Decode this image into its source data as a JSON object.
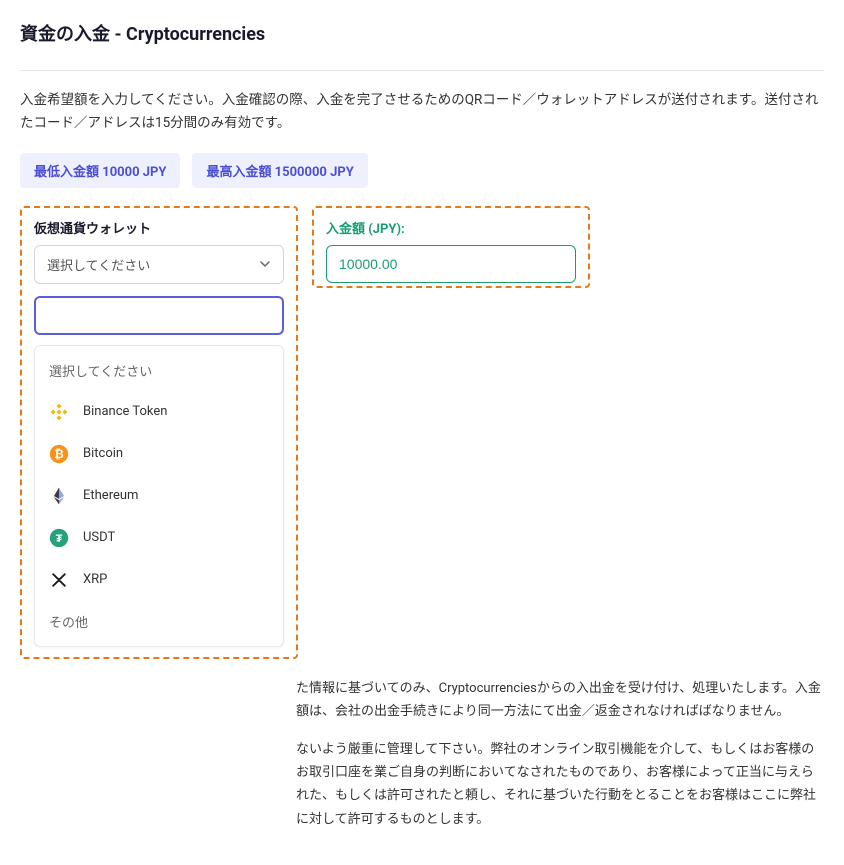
{
  "page": {
    "title": "資金の入金 - Cryptocurrencies",
    "instructions": "入金希望額を入力してください。入金確認の際、入金を完了させるためのQRコード／ウォレットアドレスが送付されます。送付されたコード／アドレスは15分間のみ有効です。"
  },
  "badges": {
    "min": "最低入金額 10000 JPY",
    "max": "最高入金額 1500000 JPY"
  },
  "wallet": {
    "label": "仮想通貨ウォレット",
    "placeholder": "選択してください",
    "options": {
      "placeholder": "選択してください",
      "binance": "Binance Token",
      "bitcoin": "Bitcoin",
      "ethereum": "Ethereum",
      "usdt": "USDT",
      "xrp": "XRP",
      "other": "その他"
    }
  },
  "amount": {
    "label": "入金額 (JPY):",
    "value": "10000.00"
  },
  "body": {
    "p1": "た情報に基づいてのみ、Cryptocurrenciesからの入出金を受け付け、処理いたします。入金額は、会社の出金手続きにより同一方法にて出金／返金されなければばなりません。",
    "p2": "ないよう厳重に管理して下さい。弊社のオンライン取引機能を介して、もしくはお客様のお取引口座を業ご自身の判断においてなされたものであり、お客様によって正当に与えられた、もしくは許可されたと頼し、それに基づいた行動をとることをお客様はここに弊社に対して許可するものとします。"
  }
}
